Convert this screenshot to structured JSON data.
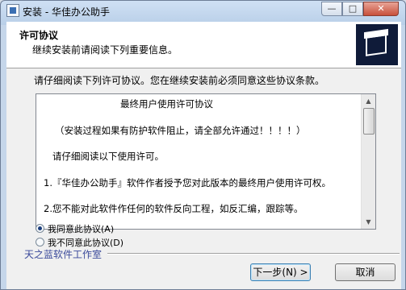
{
  "window": {
    "title": "安装 - 华佳办公助手",
    "min_glyph": "—",
    "max_glyph": "□",
    "close_glyph": "✕"
  },
  "header": {
    "title": "许可协议",
    "subtitle": "继续安装前请阅读下列重要信息。"
  },
  "intro_text": "请仔细阅读下列许可协议。您在继续安装前必须同意这些协议条款。",
  "license": {
    "lines": [
      "最终用户使用许可协议",
      "（安装过程如果有防护软件阻止，请全部允许通过！！！！）",
      "请仔细阅读以下使用许可。",
      "1.『华佳办公助手』软件作者授予您对此版本的最终用户使用许可权。",
      "2.您不能对此软件作任何的软件反向工程，如反汇编，跟踪等。"
    ],
    "scroll_up": "▲",
    "scroll_down": "▼"
  },
  "options": {
    "accept_label": "我同意此协议(A)",
    "decline_label": "我不同意此协议(D)",
    "selected": "accept"
  },
  "footer": {
    "studio": "天之蓝软件工作室",
    "next_label": "下一步(N) >",
    "cancel_label": "取消"
  }
}
